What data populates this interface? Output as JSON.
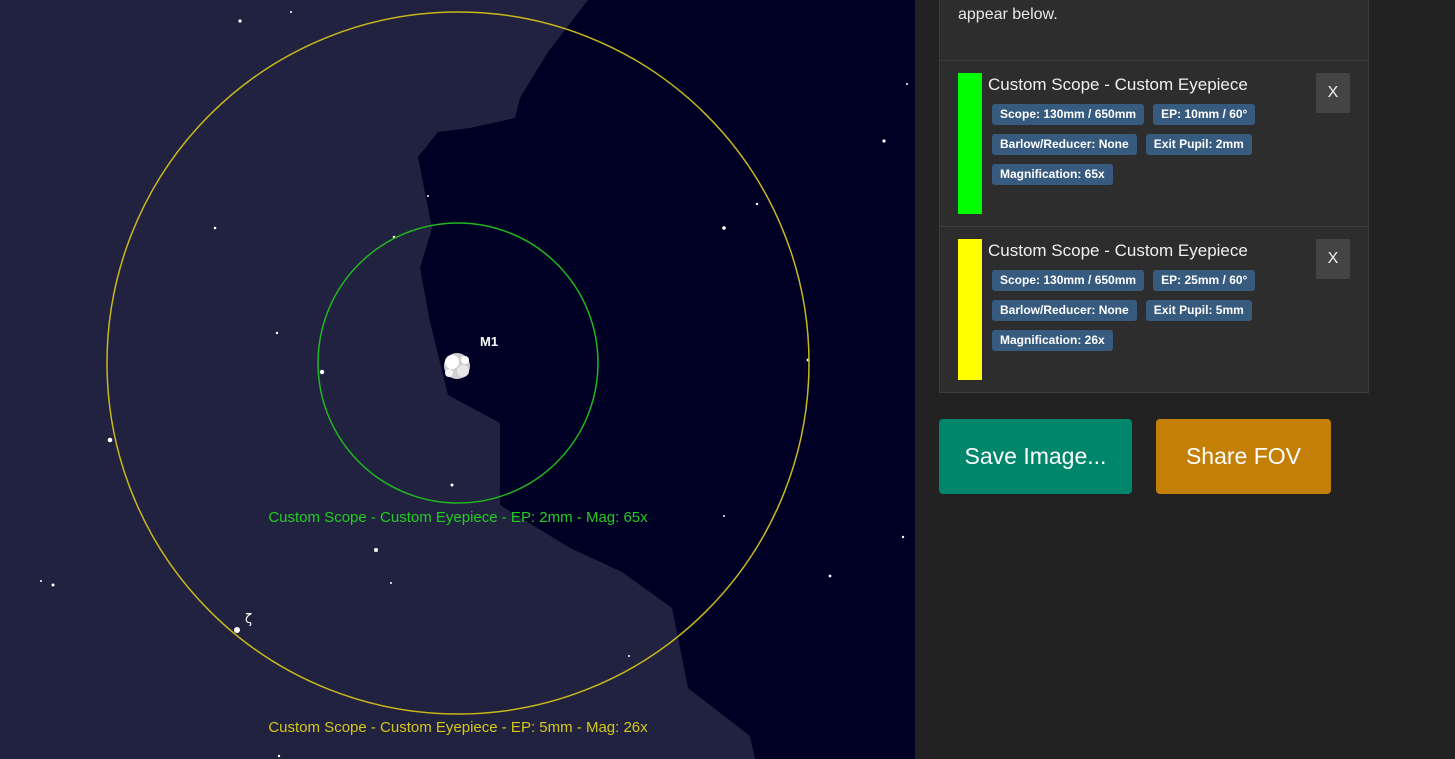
{
  "sky": {
    "object_label": "M1",
    "star_label": "ζ",
    "fov_labels": [
      {
        "text": "Custom Scope - Custom Eyepiece - EP: 2mm - Mag: 65x",
        "color": "#22cc22"
      },
      {
        "text": "Custom Scope - Custom Eyepiece - EP: 5mm - Mag: 26x",
        "color": "#d6c81a"
      }
    ],
    "colors": {
      "milky_way": "#21223f",
      "deep_sky": "#000024",
      "green_circle": "#1fb81f",
      "yellow_circle": "#c8b81a"
    }
  },
  "intro": {
    "text": "appear below."
  },
  "fov_list": [
    {
      "title": "Custom Scope - Custom Eyepiece",
      "color": "#00ff00",
      "badges": [
        "Scope: 130mm / 650mm",
        "EP: 10mm / 60°",
        "Barlow/Reducer: None",
        "Exit Pupil: 2mm",
        "Magnification: 65x"
      ],
      "remove_label": "X"
    },
    {
      "title": "Custom Scope - Custom Eyepiece",
      "color": "#ffff00",
      "badges": [
        "Scope: 130mm / 650mm",
        "EP: 25mm / 60°",
        "Barlow/Reducer: None",
        "Exit Pupil: 5mm",
        "Magnification: 26x"
      ],
      "remove_label": "X"
    }
  ],
  "actions": {
    "save_label": "Save Image...",
    "share_label": "Share FOV",
    "save_color": "#00866a",
    "share_color": "#c47f06"
  }
}
